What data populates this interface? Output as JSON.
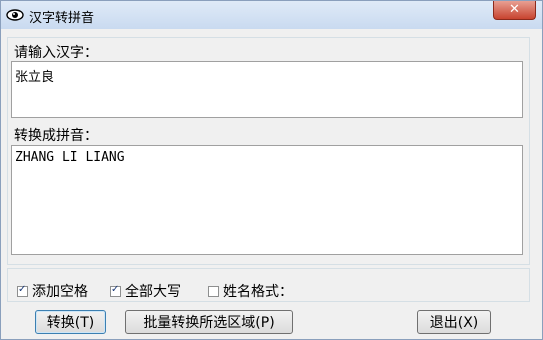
{
  "window": {
    "title": "汉字转拼音",
    "close_icon": "✕"
  },
  "input_section": {
    "label": "请输入汉字：",
    "value": "张立良"
  },
  "output_section": {
    "label": "转换成拼音：",
    "value": "ZHANG LI LIANG"
  },
  "options": [
    {
      "label": "添加空格",
      "checked": true
    },
    {
      "label": "全部大写",
      "checked": true
    },
    {
      "label": "姓名格式：",
      "checked": false
    }
  ],
  "buttons": {
    "convert": "转换(T)",
    "batch_convert": "批量转换所选区域(P)",
    "exit": "退出(X)"
  }
}
